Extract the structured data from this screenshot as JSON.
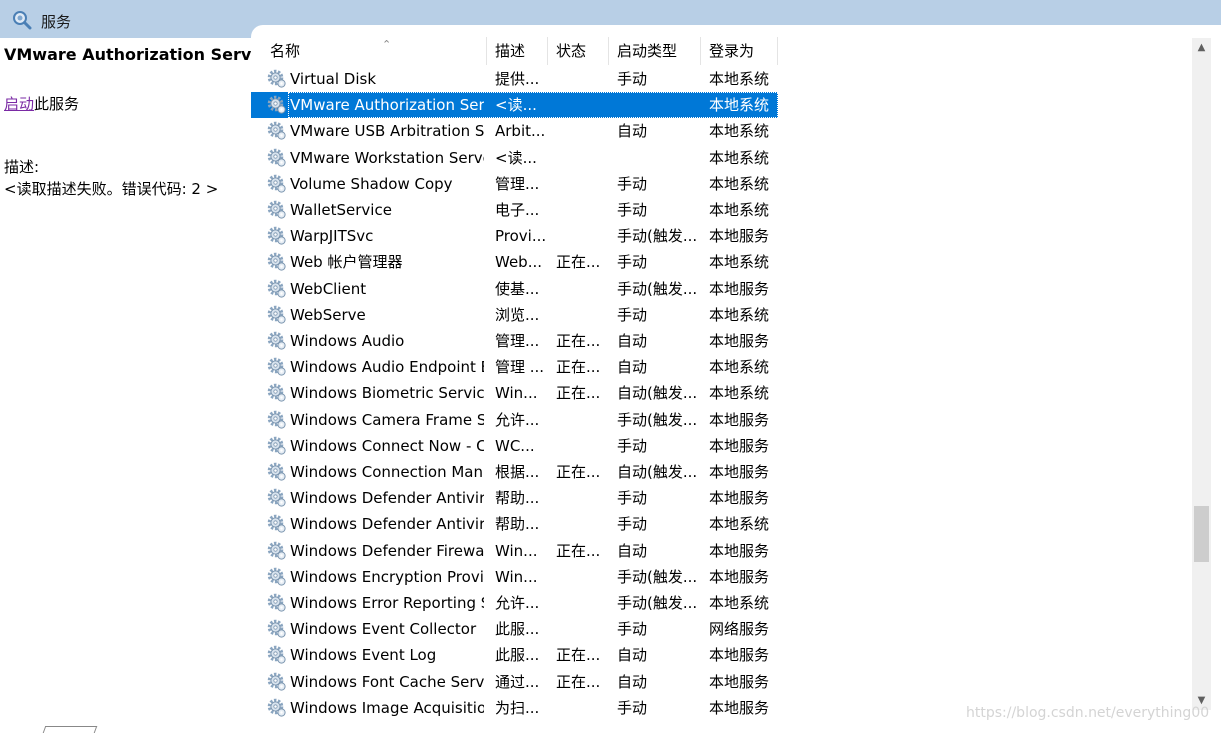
{
  "window": {
    "title": "服务",
    "icon": "services-magnifier-icon"
  },
  "left_pane": {
    "selected_service": "VMware Authorization Service",
    "action_link": "启动",
    "action_suffix": "此服务",
    "description_label": "描述:",
    "description_text": "<读取描述失败。错误代码: 2 >"
  },
  "columns": [
    "名称",
    "描述",
    "状态",
    "启动类型",
    "登录为"
  ],
  "rows": [
    {
      "name": "Virtual Disk",
      "desc": "提供...",
      "status": "",
      "startup": "手动",
      "logon": "本地系统"
    },
    {
      "name": "VMware Authorization Ser...",
      "desc": "<读...",
      "status": "",
      "startup": "",
      "logon": "本地系统",
      "selected": true
    },
    {
      "name": "VMware USB Arbitration S...",
      "desc": "Arbit...",
      "status": "",
      "startup": "自动",
      "logon": "本地系统"
    },
    {
      "name": "VMware Workstation Server",
      "desc": "<读...",
      "status": "",
      "startup": "",
      "logon": "本地系统"
    },
    {
      "name": "Volume Shadow Copy",
      "desc": "管理...",
      "status": "",
      "startup": "手动",
      "logon": "本地系统"
    },
    {
      "name": "WalletService",
      "desc": "电子...",
      "status": "",
      "startup": "手动",
      "logon": "本地系统"
    },
    {
      "name": "WarpJITSvc",
      "desc": "Provi...",
      "status": "",
      "startup": "手动(触发...",
      "logon": "本地服务"
    },
    {
      "name": "Web 帐户管理器",
      "desc": "Web...",
      "status": "正在...",
      "startup": "手动",
      "logon": "本地系统"
    },
    {
      "name": "WebClient",
      "desc": "使基...",
      "status": "",
      "startup": "手动(触发...",
      "logon": "本地服务"
    },
    {
      "name": "WebServe",
      "desc": "浏览...",
      "status": "",
      "startup": "手动",
      "logon": "本地系统"
    },
    {
      "name": "Windows Audio",
      "desc": "管理...",
      "status": "正在...",
      "startup": "自动",
      "logon": "本地服务"
    },
    {
      "name": "Windows Audio Endpoint B...",
      "desc": "管理 ...",
      "status": "正在...",
      "startup": "自动",
      "logon": "本地系统"
    },
    {
      "name": "Windows Biometric Service",
      "desc": "Win...",
      "status": "正在...",
      "startup": "自动(触发...",
      "logon": "本地系统"
    },
    {
      "name": "Windows Camera Frame S...",
      "desc": "允许...",
      "status": "",
      "startup": "手动(触发...",
      "logon": "本地服务"
    },
    {
      "name": "Windows Connect Now - C...",
      "desc": "WC...",
      "status": "",
      "startup": "手动",
      "logon": "本地服务"
    },
    {
      "name": "Windows Connection Man...",
      "desc": "根据...",
      "status": "正在...",
      "startup": "自动(触发...",
      "logon": "本地服务"
    },
    {
      "name": "Windows Defender Antivir...",
      "desc": "帮助...",
      "status": "",
      "startup": "手动",
      "logon": "本地服务"
    },
    {
      "name": "Windows Defender Antivir...",
      "desc": "帮助...",
      "status": "",
      "startup": "手动",
      "logon": "本地系统"
    },
    {
      "name": "Windows Defender Firewall",
      "desc": "Win...",
      "status": "正在...",
      "startup": "自动",
      "logon": "本地服务"
    },
    {
      "name": "Windows Encryption Provid...",
      "desc": "Win...",
      "status": "",
      "startup": "手动(触发...",
      "logon": "本地服务"
    },
    {
      "name": "Windows Error Reporting S...",
      "desc": "允许...",
      "status": "",
      "startup": "手动(触发...",
      "logon": "本地系统"
    },
    {
      "name": "Windows Event Collector",
      "desc": "此服...",
      "status": "",
      "startup": "手动",
      "logon": "网络服务"
    },
    {
      "name": "Windows Event Log",
      "desc": "此服...",
      "status": "正在...",
      "startup": "自动",
      "logon": "本地服务"
    },
    {
      "name": "Windows Font Cache Servi...",
      "desc": "通过...",
      "status": "正在...",
      "startup": "自动",
      "logon": "本地服务"
    },
    {
      "name": "Windows Image Acquisitio...",
      "desc": "为扫...",
      "status": "",
      "startup": "手动",
      "logon": "本地服务"
    }
  ],
  "scrollbar": {
    "position": 0.7
  },
  "watermark": "https://blog.csdn.net/everything00",
  "colors": {
    "titlebar": "#b8cfe6",
    "selection": "#0078d7",
    "link": "#7a2aa4"
  }
}
